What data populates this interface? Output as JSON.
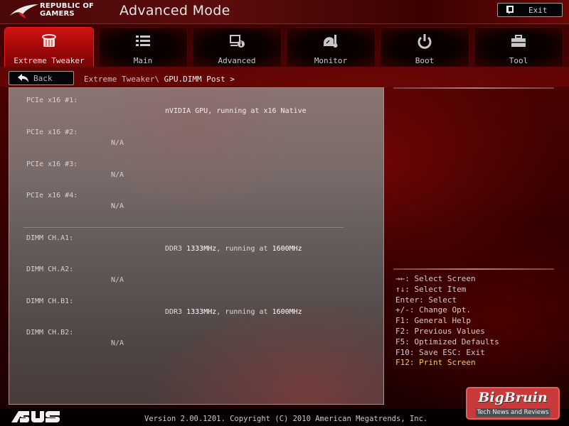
{
  "header": {
    "brand_line1": "REPUBLIC OF",
    "brand_line2": "GAMERS",
    "title": "Advanced Mode",
    "exit_label": "Exit"
  },
  "tabs": [
    {
      "label": "Extreme Tweaker",
      "icon": "tweaker-icon",
      "active": true
    },
    {
      "label": "Main",
      "icon": "list-icon",
      "active": false
    },
    {
      "label": "Advanced",
      "icon": "advanced-info-icon",
      "active": false
    },
    {
      "label": "Monitor",
      "icon": "monitor-thermometer-icon",
      "active": false
    },
    {
      "label": "Boot",
      "icon": "power-icon",
      "active": false
    },
    {
      "label": "Tool",
      "icon": "toolbox-icon",
      "active": false
    }
  ],
  "nav": {
    "back_label": "Back",
    "breadcrumb_parent": "Extreme Tweaker\\",
    "breadcrumb_current": "GPU.DIMM Post >"
  },
  "pcie": [
    {
      "label": "PCIe x16 #1:",
      "value_parts": [
        "nVIDIA GPU, running at x16 Native"
      ]
    },
    {
      "label": "PCIe x16 #2:",
      "value_parts": [
        "N/A"
      ]
    },
    {
      "label": "PCIe x16 #3:",
      "value_parts": [
        "N/A"
      ]
    },
    {
      "label": "PCIe x16 #4:",
      "value_parts": [
        "N/A"
      ]
    }
  ],
  "dimm": [
    {
      "label": "DIMM CH.A1:",
      "type": "DDR3",
      "rated": "1333MHz",
      "mid": ", running at",
      "actual": "1600MHz"
    },
    {
      "label": "DIMM CH.A2:",
      "na": "N/A"
    },
    {
      "label": "DIMM CH.B1:",
      "type": "DDR3",
      "rated": "1333MHz",
      "mid": ", running at",
      "actual": "1600MHz"
    },
    {
      "label": "DIMM CH.B2:",
      "na": "N/A"
    }
  ],
  "help": [
    "→←: Select Screen",
    "↑↓: Select Item",
    "Enter: Select",
    "+/-: Change Opt.",
    "F1: General Help",
    "F2: Previous Values",
    "F5: Optimized Defaults",
    "F10: Save  ESC: Exit",
    "F12: Print Screen"
  ],
  "footer": {
    "version": "Version 2.00.1201. Copyright (C) 2010 American Megatrends, Inc.",
    "watermark_title": "BigBruin",
    "watermark_tagline": "Tech News and Reviews"
  },
  "colors": {
    "accent_red": "#c00c0c",
    "highlight_key": "#f0c860"
  }
}
